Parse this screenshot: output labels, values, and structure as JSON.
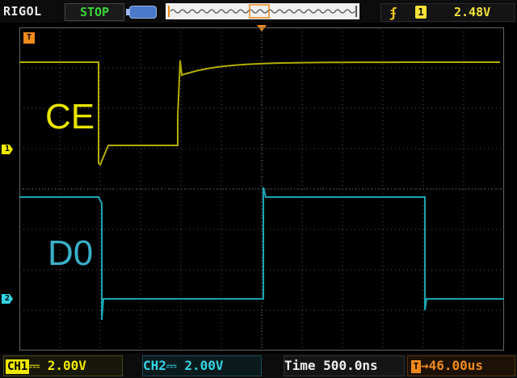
{
  "header": {
    "brand": "RIGOL",
    "run_state": "STOP",
    "trigger": {
      "edge_icon": "rising-edge-icon",
      "source": "1",
      "level": "2.48V"
    }
  },
  "screen": {
    "labels": {
      "ce": "CE",
      "d0": "D0"
    },
    "markers": {
      "ch1": "1",
      "ch2": "2",
      "trigger": "T"
    }
  },
  "footer": {
    "ch1": {
      "tag": "CH1",
      "coupling": "⎓",
      "scale": "2.00V"
    },
    "ch2": {
      "tag": "CH2",
      "coupling": "⎓",
      "scale": "2.00V"
    },
    "timebase": {
      "label": "Time",
      "value": "500.0ns"
    },
    "trigger_offset": {
      "tag": "T",
      "value": "→46.00us"
    }
  },
  "colors": {
    "ch1": "#f0ea00",
    "ch2": "#33d4e4",
    "trigger": "#f08a1a",
    "run_state": "#39d639",
    "trace_ch1": "#b4ad00",
    "trace_ch2": "#1ca4b4"
  }
}
